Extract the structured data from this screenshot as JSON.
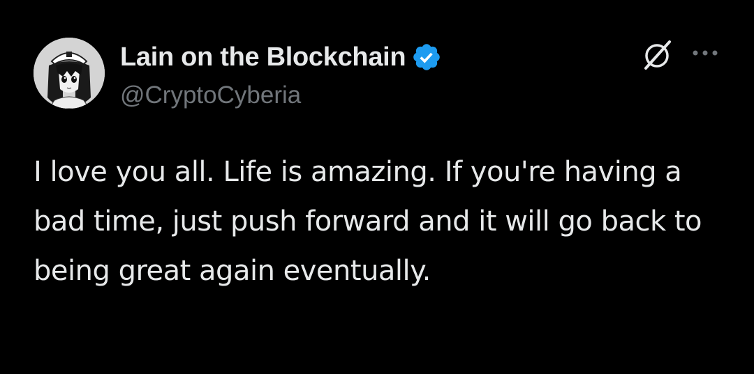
{
  "tweet": {
    "author": {
      "display_name": "Lain on the Blockchain",
      "handle": "@CryptoCyberia",
      "verified": true,
      "avatar_icon": "anime-girl-avatar"
    },
    "text": "I love you all. Life is amazing. If you're having a bad time, just push forward and it will go back to being great again eventually.",
    "actions": {
      "grok_icon": "grok-icon",
      "more_icon": "more-options-icon"
    }
  },
  "colors": {
    "background": "#000000",
    "primary_text": "#e7e9ea",
    "secondary_text": "#71767b",
    "verified_blue": "#1d9bf0"
  }
}
